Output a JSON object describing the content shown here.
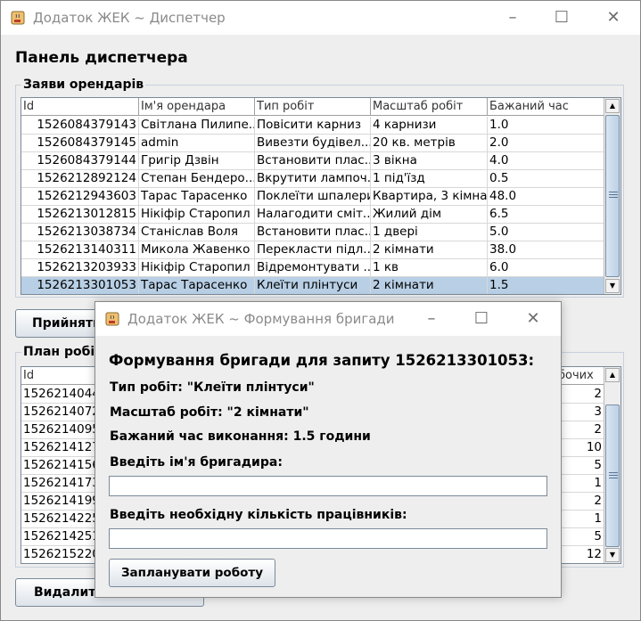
{
  "main_window": {
    "title": "Додаток ЖЕК ~ Диспетчер",
    "panel_title": "Панель диспетчера",
    "requests": {
      "legend": "Заяви орендарів",
      "columns": [
        "Id",
        "Ім'я орендара",
        "Тип робіт",
        "Масштаб робіт",
        "Бажаний час"
      ],
      "rows": [
        [
          "1526084379143",
          "Світлана Пилипе...",
          "Повісити карниз",
          "4 карнизи",
          "1.0"
        ],
        [
          "1526084379145",
          "admin",
          "Вивезти будівел...",
          "20 кв. метрів",
          "2.0"
        ],
        [
          "1526084379144",
          "Григір Дзвін",
          "Встановити плас...",
          "3 вікна",
          "4.0"
        ],
        [
          "1526212892124",
          "Степан Бендеро...",
          "Вкрутити лампоч...",
          "1 під'їзд",
          "0.5"
        ],
        [
          "1526212943603",
          "Тарас Тарасенко",
          "Поклеїти шпалери",
          "Квартира, 3 кімна...",
          "48.0"
        ],
        [
          "1526213012815",
          "Нікіфір Старопил",
          "Налагодити сміт...",
          "Жилий дім",
          "6.5"
        ],
        [
          "1526213038734",
          "Станіслав Воля",
          "Встановити плас...",
          "1 двері",
          "5.0"
        ],
        [
          "1526213140311",
          "Микола Жавенко",
          "Перекласти підл...",
          "2 кімнати",
          "38.0"
        ],
        [
          "1526213203933",
          "Нікіфір Старопил",
          "Відремонтувати ...",
          "1 кв",
          "6.0"
        ],
        [
          "1526213301053",
          "Тарас Тарасенко",
          "Клеїти плінтуси",
          "2 кімнати",
          "1.5"
        ]
      ],
      "selected_row": 9
    },
    "accept_button": "Прийняти",
    "plan": {
      "legend": "План робіт",
      "columns": [
        "Id",
        "бочих"
      ],
      "rows": [
        [
          "1526214044",
          "2"
        ],
        [
          "1526214072",
          "3"
        ],
        [
          "1526214095",
          "2"
        ],
        [
          "1526214127",
          "10"
        ],
        [
          "1526214156",
          "5"
        ],
        [
          "1526214173",
          "1"
        ],
        [
          "1526214199",
          "2"
        ],
        [
          "1526214225",
          "1"
        ],
        [
          "1526214251",
          "5"
        ],
        [
          "1526215220",
          "12"
        ]
      ]
    },
    "delete_button": "Видалити"
  },
  "dialog": {
    "title": "Додаток ЖЕК ~ Формування бригади",
    "heading": "Формування бригади для запиту 1526213301053:",
    "work_type": "Тип робіт: \"Клеїти плінтуси\"",
    "work_scale": "Масштаб робіт: \"2 кімнати\"",
    "desired_time": "Бажаний час виконання: 1.5 години",
    "foreman_label": "Введіть ім'я бригадира:",
    "foreman_value": "",
    "workers_label": "Введіть необхідну кількість працівників:",
    "workers_value": "",
    "submit_button": "Запланувати роботу"
  },
  "window_controls": {
    "minimize": "–",
    "maximize": "☐",
    "close": "✕"
  },
  "icons": {
    "app": "java-cup-icon"
  },
  "colors": {
    "selected_row": "#b8cfe5",
    "window_bg": "#eeeeee",
    "titlebar": "#ffffff",
    "title_text": "#8a8a8a"
  }
}
